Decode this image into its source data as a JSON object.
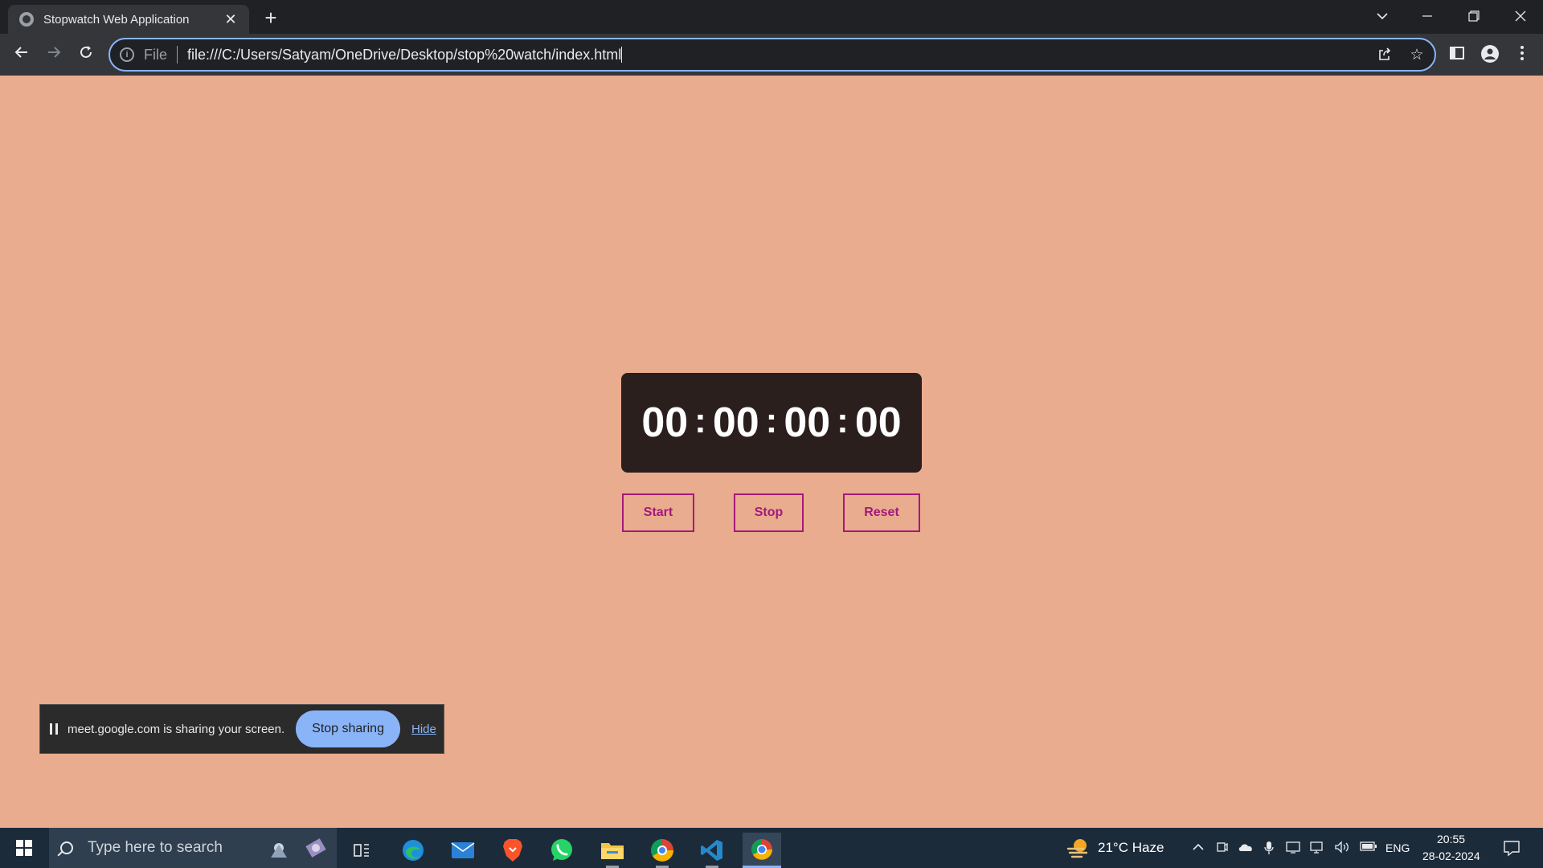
{
  "browser": {
    "tab_title": "Stopwatch Web Application",
    "tab_close": "✕",
    "new_tab": "+",
    "scheme_label": "File",
    "url": "file:///C:/Users/Satyam/OneDrive/Desktop/stop%20watch/index.html"
  },
  "stopwatch": {
    "hours": "00",
    "minutes": "00",
    "seconds": "00",
    "centiseconds": "00",
    "separator": ":",
    "buttons": {
      "start": "Start",
      "stop": "Stop",
      "reset": "Reset"
    }
  },
  "share_bar": {
    "message": "meet.google.com is sharing your screen.",
    "stop_button": "Stop sharing",
    "hide_link": "Hide"
  },
  "taskbar": {
    "search_placeholder": "Type here to search",
    "weather": "21°C  Haze",
    "language": "ENG",
    "time": "20:55",
    "date": "28-02-2024"
  },
  "colors": {
    "page_bg": "#e9ac8f",
    "display_bg": "#2a1f1d",
    "button_accent": "#a3197a",
    "chrome_dark": "#202124",
    "chrome_accent": "#8ab4f8"
  }
}
